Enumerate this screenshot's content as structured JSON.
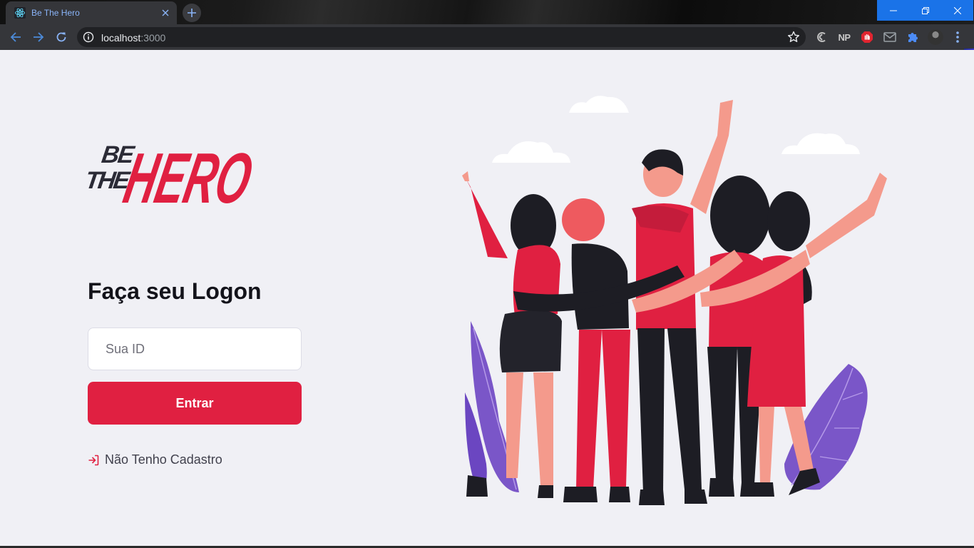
{
  "browser": {
    "tab_title": "Be The Hero",
    "url_host": "localhost",
    "url_port": ":3000",
    "extension_np_label": "NP",
    "icons": [
      "react-favicon-icon",
      "close-icon",
      "plus-icon",
      "minimize-icon",
      "restore-icon",
      "window-close-icon",
      "back-icon",
      "forward-icon",
      "reload-icon",
      "info-icon",
      "star-icon",
      "extension-icon",
      "puzzle-icon",
      "mail-icon",
      "stop-icon",
      "avatar",
      "more-vert-icon"
    ]
  },
  "logo": {
    "line1": "BE",
    "line2": "THE",
    "line3": "HERO"
  },
  "login": {
    "title": "Faça seu Logon",
    "id_placeholder": "Sua ID",
    "id_value": "",
    "submit_label": "Entrar",
    "register_label": "Não Tenho Cadastro"
  },
  "colors": {
    "brand_red": "#e02041",
    "background": "#f0f0f5",
    "text_dark": "#13131a",
    "text_muted": "#41414d"
  }
}
